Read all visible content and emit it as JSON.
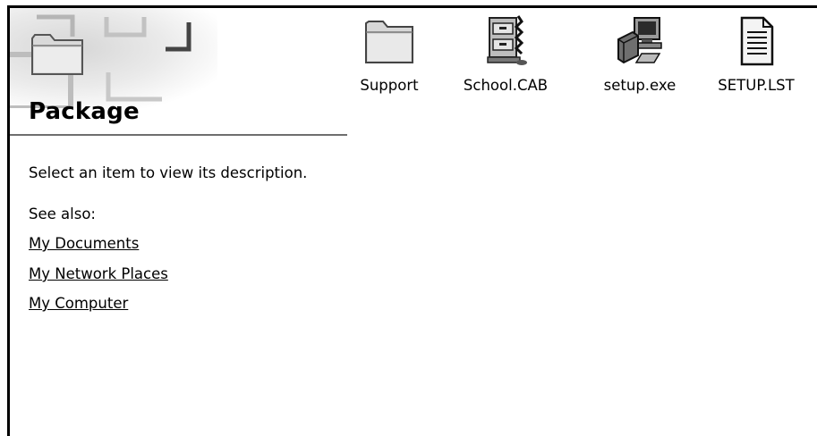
{
  "header": {
    "title": "Package"
  },
  "left_pane": {
    "description": "Select an item to view its description.",
    "see_also_label": "See also:",
    "links": [
      {
        "label": "My Documents"
      },
      {
        "label": "My Network Places"
      },
      {
        "label": "My Computer"
      }
    ]
  },
  "files": [
    {
      "name": "Support",
      "icon": "folder-icon"
    },
    {
      "name": "School.CAB",
      "icon": "cabinet-archive-icon"
    },
    {
      "name": "setup.exe",
      "icon": "setup-installer-icon"
    },
    {
      "name": "SETUP.LST",
      "icon": "text-document-icon"
    }
  ]
}
